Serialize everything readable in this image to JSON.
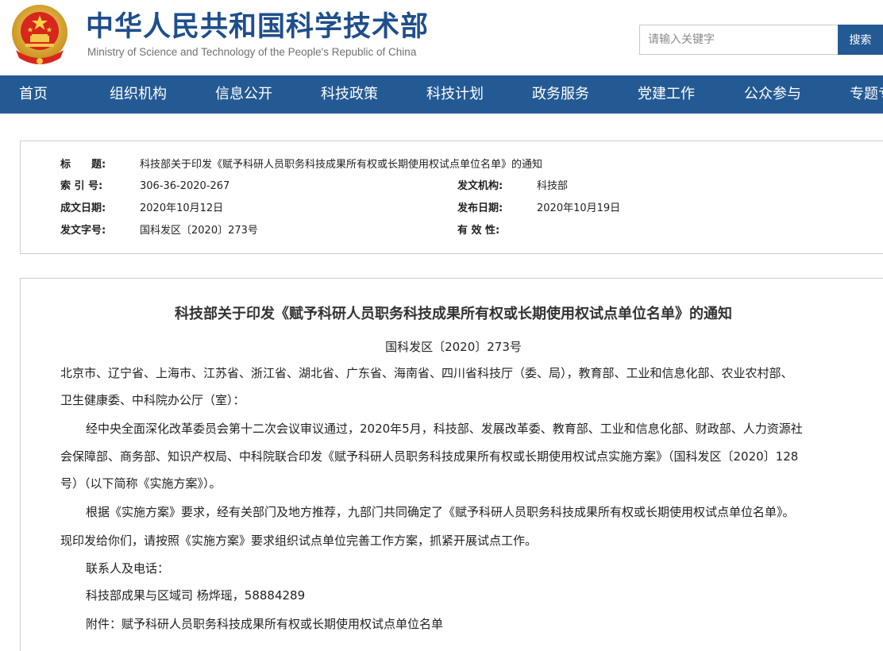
{
  "header": {
    "title": "中华人民共和国科学技术部",
    "subtitle": "Ministry of Science and Technology of the People's Republic of China",
    "emblem_icon": "national-emblem-icon",
    "search_placeholder": "请输入关键字",
    "search_button": "搜索",
    "brand_color": "#1f4e8c",
    "nav_color": "#245a94"
  },
  "nav": {
    "items": [
      "首页",
      "组织机构",
      "信息公开",
      "科技政策",
      "科技计划",
      "政务服务",
      "党建工作",
      "公众参与",
      "专题专栏"
    ]
  },
  "meta": {
    "title_label": "标　　题:",
    "title_value": "科技部关于印发《赋予科研人员职务科技成果所有权或长期使用权试点单位名单》的通知",
    "index_label": "索 引 号:",
    "index_value": "306-36-2020-267",
    "issuer_label": "发文机构:",
    "issuer_value": "科技部",
    "created_label": "成文日期:",
    "created_value": "2020年10月12日",
    "published_label": "发布日期:",
    "published_value": "2020年10月19日",
    "docno_label": "发文字号:",
    "docno_value": "国科发区〔2020〕273号",
    "validity_label": "有 效 性:",
    "validity_value": ""
  },
  "article": {
    "title": "科技部关于印发《赋予科研人员职务科技成果所有权或长期使用权试点单位名单》的通知",
    "doc_number": "国科发区〔2020〕273号",
    "lines": [
      "北京市、辽宁省、上海市、江苏省、浙江省、湖北省、广东省、海南省、四川省科技厅（委、局），教育部、工业和信息化部、农业农村部、",
      "卫生健康委、中科院办公厅（室）：",
      "经中央全面深化改革委员会第十二次会议审议通过，2020年5月，科技部、发展改革委、教育部、工业和信息化部、财政部、人力资源社",
      "会保障部、商务部、知识产权局、中科院联合印发《赋予科研人员职务科技成果所有权或长期使用权试点实施方案》（国科发区〔2020〕128",
      "号）（以下简称《实施方案》）。",
      "根据《实施方案》要求，经有关部门及地方推荐，九部门共同确定了《赋予科研人员职务科技成果所有权或长期使用权试点单位名单》。",
      "现印发给你们，请按照《实施方案》要求组织试点单位完善工作方案，抓紧开展试点工作。",
      "联系人及电话：",
      "科技部成果与区域司  杨烨瑶，58884289",
      "附件：赋予科研人员职务科技成果所有权或长期使用权试点单位名单"
    ]
  }
}
